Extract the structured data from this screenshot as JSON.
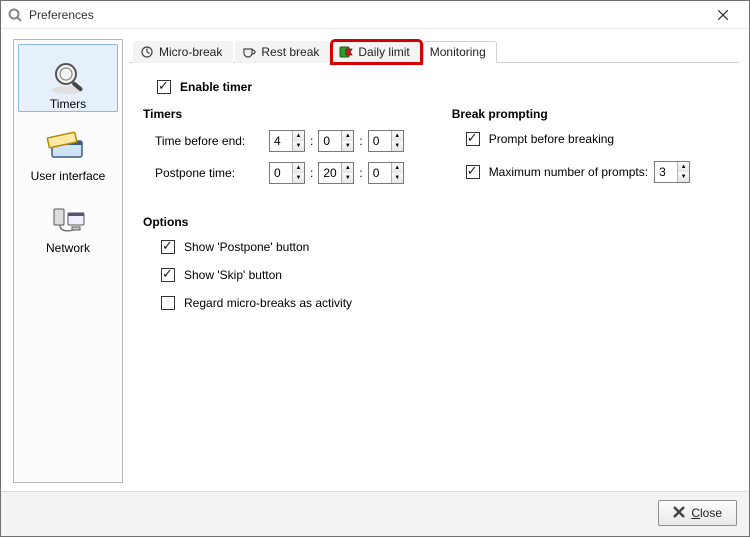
{
  "window": {
    "title": "Preferences"
  },
  "sidebar": {
    "items": [
      {
        "label": "Timers"
      },
      {
        "label": "User interface"
      },
      {
        "label": "Network"
      }
    ]
  },
  "tabs": {
    "items": [
      {
        "label": "Micro-break"
      },
      {
        "label": "Rest break"
      },
      {
        "label": "Daily limit"
      },
      {
        "label": "Monitoring"
      }
    ]
  },
  "pane": {
    "enable_timer": {
      "label": "Enable timer",
      "checked": true
    },
    "timers_heading": "Timers",
    "break_heading": "Break prompting",
    "time_before_end": {
      "label": "Time before end:",
      "h": "4",
      "m": "0",
      "s": "0"
    },
    "postpone_time": {
      "label": "Postpone time:",
      "h": "0",
      "m": "20",
      "s": "0"
    },
    "prompt_before": {
      "label": "Prompt before breaking",
      "checked": true
    },
    "max_prompts": {
      "label": "Maximum number of prompts:",
      "checked": true,
      "value": "3"
    },
    "options_heading": "Options",
    "show_postpone": {
      "label": "Show 'Postpone' button",
      "checked": true
    },
    "show_skip": {
      "label": "Show 'Skip' button",
      "checked": true
    },
    "regard_micro": {
      "label": "Regard micro-breaks as activity",
      "checked": false
    }
  },
  "footer": {
    "close_prefix": "C",
    "close_rest": "lose"
  }
}
